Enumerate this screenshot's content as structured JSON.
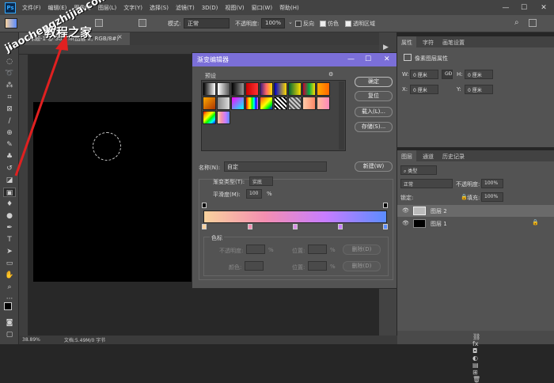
{
  "app": {
    "logo": "Ps",
    "menu": [
      "文件(F)",
      "编辑(E)",
      "图像(I)",
      "图层(L)",
      "文字(Y)",
      "选择(S)",
      "滤镜(T)",
      "3D(D)",
      "视图(V)",
      "窗口(W)",
      "帮助(H)"
    ]
  },
  "options": {
    "mode_label": "模式:",
    "mode_value": "正常",
    "opacity_label": "不透明度:",
    "opacity_value": "100%",
    "reverse": "反向",
    "dither": "仿色",
    "transparency": "透明区域"
  },
  "document": {
    "tab": "未标题-1 @ 38.9%(图层 2, RGB/8#)",
    "zoom": "38.89%",
    "info": "文档:5.49M/0 字节"
  },
  "properties": {
    "tabs": [
      "属性",
      "字符",
      "画笔设置"
    ],
    "kind": "像素图层属性",
    "w_label": "W:",
    "w_value": "0 厘米",
    "h_label": "H:",
    "h_value": "0 厘米",
    "x_label": "X:",
    "x_value": "0 厘米",
    "y_label": "Y:",
    "y_value": "0 厘米",
    "link": "GĐ"
  },
  "layers": {
    "tabs": [
      "图层",
      "通道",
      "历史记录"
    ],
    "filter": "类型",
    "blend": "正常",
    "opacity_label": "不透明度:",
    "opacity_value": "100%",
    "lock_label": "锁定:",
    "fill_label": "填充:",
    "fill_value": "100%",
    "items": [
      {
        "name": "图层 2"
      },
      {
        "name": "图层 1"
      }
    ]
  },
  "dialog": {
    "title": "渐变编辑器",
    "presets_label": "预设",
    "ok": "确定",
    "reset": "复位",
    "load": "载入(L)...",
    "save": "存储(S)...",
    "name_label": "名称(N):",
    "name_value": "自定",
    "new": "新建(W)",
    "type_label": "渐变类型(T):",
    "type_value": "实底",
    "smooth_label": "平滑度(M):",
    "smooth_value": "100",
    "percent": "%",
    "color_stop_label": "色标",
    "opacity_label": "不透明度:",
    "location_label": "位置:",
    "delete": "删除(D)",
    "color_label": "颜色:"
  },
  "watermark": {
    "line1": "jiaochengzhijia.com",
    "line2": "教程之家"
  },
  "colors": {
    "accent": "#7b6fd8",
    "gradient": [
      "#f9d29d",
      "#f48fb1",
      "#c77dff",
      "#5b8cff"
    ]
  }
}
